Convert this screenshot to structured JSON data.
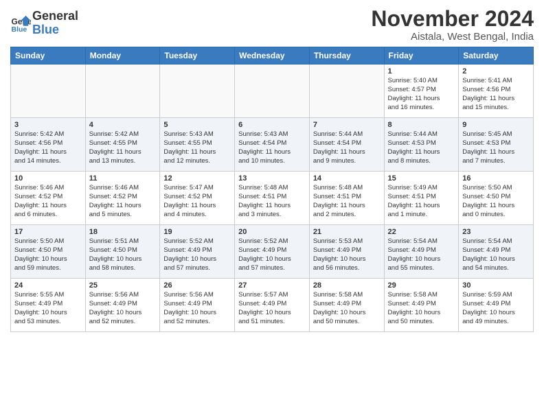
{
  "header": {
    "logo_line1": "General",
    "logo_line2": "Blue",
    "month": "November 2024",
    "location": "Aistala, West Bengal, India"
  },
  "weekdays": [
    "Sunday",
    "Monday",
    "Tuesday",
    "Wednesday",
    "Thursday",
    "Friday",
    "Saturday"
  ],
  "weeks": [
    [
      {
        "day": "",
        "detail": ""
      },
      {
        "day": "",
        "detail": ""
      },
      {
        "day": "",
        "detail": ""
      },
      {
        "day": "",
        "detail": ""
      },
      {
        "day": "",
        "detail": ""
      },
      {
        "day": "1",
        "detail": "Sunrise: 5:40 AM\nSunset: 4:57 PM\nDaylight: 11 hours\nand 16 minutes."
      },
      {
        "day": "2",
        "detail": "Sunrise: 5:41 AM\nSunset: 4:56 PM\nDaylight: 11 hours\nand 15 minutes."
      }
    ],
    [
      {
        "day": "3",
        "detail": "Sunrise: 5:42 AM\nSunset: 4:56 PM\nDaylight: 11 hours\nand 14 minutes."
      },
      {
        "day": "4",
        "detail": "Sunrise: 5:42 AM\nSunset: 4:55 PM\nDaylight: 11 hours\nand 13 minutes."
      },
      {
        "day": "5",
        "detail": "Sunrise: 5:43 AM\nSunset: 4:55 PM\nDaylight: 11 hours\nand 12 minutes."
      },
      {
        "day": "6",
        "detail": "Sunrise: 5:43 AM\nSunset: 4:54 PM\nDaylight: 11 hours\nand 10 minutes."
      },
      {
        "day": "7",
        "detail": "Sunrise: 5:44 AM\nSunset: 4:54 PM\nDaylight: 11 hours\nand 9 minutes."
      },
      {
        "day": "8",
        "detail": "Sunrise: 5:44 AM\nSunset: 4:53 PM\nDaylight: 11 hours\nand 8 minutes."
      },
      {
        "day": "9",
        "detail": "Sunrise: 5:45 AM\nSunset: 4:53 PM\nDaylight: 11 hours\nand 7 minutes."
      }
    ],
    [
      {
        "day": "10",
        "detail": "Sunrise: 5:46 AM\nSunset: 4:52 PM\nDaylight: 11 hours\nand 6 minutes."
      },
      {
        "day": "11",
        "detail": "Sunrise: 5:46 AM\nSunset: 4:52 PM\nDaylight: 11 hours\nand 5 minutes."
      },
      {
        "day": "12",
        "detail": "Sunrise: 5:47 AM\nSunset: 4:52 PM\nDaylight: 11 hours\nand 4 minutes."
      },
      {
        "day": "13",
        "detail": "Sunrise: 5:48 AM\nSunset: 4:51 PM\nDaylight: 11 hours\nand 3 minutes."
      },
      {
        "day": "14",
        "detail": "Sunrise: 5:48 AM\nSunset: 4:51 PM\nDaylight: 11 hours\nand 2 minutes."
      },
      {
        "day": "15",
        "detail": "Sunrise: 5:49 AM\nSunset: 4:51 PM\nDaylight: 11 hours\nand 1 minute."
      },
      {
        "day": "16",
        "detail": "Sunrise: 5:50 AM\nSunset: 4:50 PM\nDaylight: 11 hours\nand 0 minutes."
      }
    ],
    [
      {
        "day": "17",
        "detail": "Sunrise: 5:50 AM\nSunset: 4:50 PM\nDaylight: 10 hours\nand 59 minutes."
      },
      {
        "day": "18",
        "detail": "Sunrise: 5:51 AM\nSunset: 4:50 PM\nDaylight: 10 hours\nand 58 minutes."
      },
      {
        "day": "19",
        "detail": "Sunrise: 5:52 AM\nSunset: 4:49 PM\nDaylight: 10 hours\nand 57 minutes."
      },
      {
        "day": "20",
        "detail": "Sunrise: 5:52 AM\nSunset: 4:49 PM\nDaylight: 10 hours\nand 57 minutes."
      },
      {
        "day": "21",
        "detail": "Sunrise: 5:53 AM\nSunset: 4:49 PM\nDaylight: 10 hours\nand 56 minutes."
      },
      {
        "day": "22",
        "detail": "Sunrise: 5:54 AM\nSunset: 4:49 PM\nDaylight: 10 hours\nand 55 minutes."
      },
      {
        "day": "23",
        "detail": "Sunrise: 5:54 AM\nSunset: 4:49 PM\nDaylight: 10 hours\nand 54 minutes."
      }
    ],
    [
      {
        "day": "24",
        "detail": "Sunrise: 5:55 AM\nSunset: 4:49 PM\nDaylight: 10 hours\nand 53 minutes."
      },
      {
        "day": "25",
        "detail": "Sunrise: 5:56 AM\nSunset: 4:49 PM\nDaylight: 10 hours\nand 52 minutes."
      },
      {
        "day": "26",
        "detail": "Sunrise: 5:56 AM\nSunset: 4:49 PM\nDaylight: 10 hours\nand 52 minutes."
      },
      {
        "day": "27",
        "detail": "Sunrise: 5:57 AM\nSunset: 4:49 PM\nDaylight: 10 hours\nand 51 minutes."
      },
      {
        "day": "28",
        "detail": "Sunrise: 5:58 AM\nSunset: 4:49 PM\nDaylight: 10 hours\nand 50 minutes."
      },
      {
        "day": "29",
        "detail": "Sunrise: 5:58 AM\nSunset: 4:49 PM\nDaylight: 10 hours\nand 50 minutes."
      },
      {
        "day": "30",
        "detail": "Sunrise: 5:59 AM\nSunset: 4:49 PM\nDaylight: 10 hours\nand 49 minutes."
      }
    ]
  ]
}
